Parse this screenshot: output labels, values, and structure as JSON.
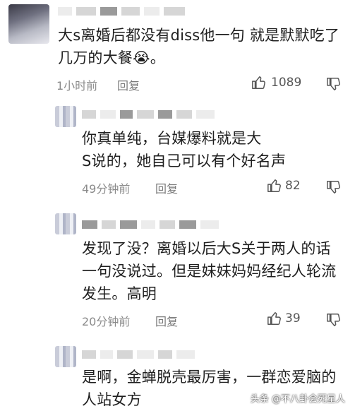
{
  "comments": [
    {
      "text_line1": "大s离婚后都没有diss他一句 就是默默吃了",
      "text_line2": "几万的大餐",
      "emoji": "😭",
      "text_end": "。",
      "time": "1小时前",
      "reply_label": "回复",
      "likes": "1089"
    },
    {
      "text_line1": "你真单纯，台媒爆料就是大",
      "text_line2": "S说的，她自己可以有个好名声",
      "time": "49分钟前",
      "reply_label": "回复",
      "likes": "82"
    },
    {
      "text_line1": "发现了没？离婚以后大S关于两人的话",
      "text_line2": "一句没说过。但是妹妹妈妈经纪人轮流",
      "text_line3": "发生。高明",
      "time": "20分钟前",
      "reply_label": "回复",
      "likes": "39"
    },
    {
      "text_line1": "是啊，金蝉脱壳最厉害，一群恋爱脑的",
      "text_line2": "人站女方"
    }
  ],
  "watermark": "头条 @不八卦会死星人",
  "icons": {
    "like": "thumbs-up-icon",
    "dislike": "thumbs-down-icon"
  }
}
